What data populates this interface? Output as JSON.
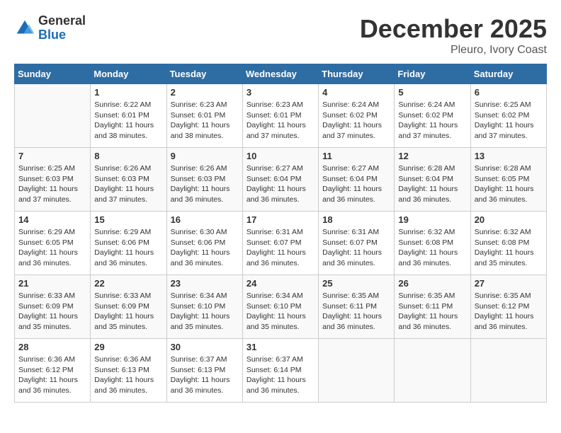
{
  "header": {
    "logo_general": "General",
    "logo_blue": "Blue",
    "month_title": "December 2025",
    "location": "Pleuro, Ivory Coast"
  },
  "weekdays": [
    "Sunday",
    "Monday",
    "Tuesday",
    "Wednesday",
    "Thursday",
    "Friday",
    "Saturday"
  ],
  "weeks": [
    [
      {
        "day": "",
        "sunrise": "",
        "sunset": "",
        "daylight": ""
      },
      {
        "day": "1",
        "sunrise": "Sunrise: 6:22 AM",
        "sunset": "Sunset: 6:01 PM",
        "daylight": "Daylight: 11 hours and 38 minutes."
      },
      {
        "day": "2",
        "sunrise": "Sunrise: 6:23 AM",
        "sunset": "Sunset: 6:01 PM",
        "daylight": "Daylight: 11 hours and 38 minutes."
      },
      {
        "day": "3",
        "sunrise": "Sunrise: 6:23 AM",
        "sunset": "Sunset: 6:01 PM",
        "daylight": "Daylight: 11 hours and 37 minutes."
      },
      {
        "day": "4",
        "sunrise": "Sunrise: 6:24 AM",
        "sunset": "Sunset: 6:02 PM",
        "daylight": "Daylight: 11 hours and 37 minutes."
      },
      {
        "day": "5",
        "sunrise": "Sunrise: 6:24 AM",
        "sunset": "Sunset: 6:02 PM",
        "daylight": "Daylight: 11 hours and 37 minutes."
      },
      {
        "day": "6",
        "sunrise": "Sunrise: 6:25 AM",
        "sunset": "Sunset: 6:02 PM",
        "daylight": "Daylight: 11 hours and 37 minutes."
      }
    ],
    [
      {
        "day": "7",
        "sunrise": "Sunrise: 6:25 AM",
        "sunset": "Sunset: 6:03 PM",
        "daylight": "Daylight: 11 hours and 37 minutes."
      },
      {
        "day": "8",
        "sunrise": "Sunrise: 6:26 AM",
        "sunset": "Sunset: 6:03 PM",
        "daylight": "Daylight: 11 hours and 37 minutes."
      },
      {
        "day": "9",
        "sunrise": "Sunrise: 6:26 AM",
        "sunset": "Sunset: 6:03 PM",
        "daylight": "Daylight: 11 hours and 36 minutes."
      },
      {
        "day": "10",
        "sunrise": "Sunrise: 6:27 AM",
        "sunset": "Sunset: 6:04 PM",
        "daylight": "Daylight: 11 hours and 36 minutes."
      },
      {
        "day": "11",
        "sunrise": "Sunrise: 6:27 AM",
        "sunset": "Sunset: 6:04 PM",
        "daylight": "Daylight: 11 hours and 36 minutes."
      },
      {
        "day": "12",
        "sunrise": "Sunrise: 6:28 AM",
        "sunset": "Sunset: 6:04 PM",
        "daylight": "Daylight: 11 hours and 36 minutes."
      },
      {
        "day": "13",
        "sunrise": "Sunrise: 6:28 AM",
        "sunset": "Sunset: 6:05 PM",
        "daylight": "Daylight: 11 hours and 36 minutes."
      }
    ],
    [
      {
        "day": "14",
        "sunrise": "Sunrise: 6:29 AM",
        "sunset": "Sunset: 6:05 PM",
        "daylight": "Daylight: 11 hours and 36 minutes."
      },
      {
        "day": "15",
        "sunrise": "Sunrise: 6:29 AM",
        "sunset": "Sunset: 6:06 PM",
        "daylight": "Daylight: 11 hours and 36 minutes."
      },
      {
        "day": "16",
        "sunrise": "Sunrise: 6:30 AM",
        "sunset": "Sunset: 6:06 PM",
        "daylight": "Daylight: 11 hours and 36 minutes."
      },
      {
        "day": "17",
        "sunrise": "Sunrise: 6:31 AM",
        "sunset": "Sunset: 6:07 PM",
        "daylight": "Daylight: 11 hours and 36 minutes."
      },
      {
        "day": "18",
        "sunrise": "Sunrise: 6:31 AM",
        "sunset": "Sunset: 6:07 PM",
        "daylight": "Daylight: 11 hours and 36 minutes."
      },
      {
        "day": "19",
        "sunrise": "Sunrise: 6:32 AM",
        "sunset": "Sunset: 6:08 PM",
        "daylight": "Daylight: 11 hours and 36 minutes."
      },
      {
        "day": "20",
        "sunrise": "Sunrise: 6:32 AM",
        "sunset": "Sunset: 6:08 PM",
        "daylight": "Daylight: 11 hours and 35 minutes."
      }
    ],
    [
      {
        "day": "21",
        "sunrise": "Sunrise: 6:33 AM",
        "sunset": "Sunset: 6:09 PM",
        "daylight": "Daylight: 11 hours and 35 minutes."
      },
      {
        "day": "22",
        "sunrise": "Sunrise: 6:33 AM",
        "sunset": "Sunset: 6:09 PM",
        "daylight": "Daylight: 11 hours and 35 minutes."
      },
      {
        "day": "23",
        "sunrise": "Sunrise: 6:34 AM",
        "sunset": "Sunset: 6:10 PM",
        "daylight": "Daylight: 11 hours and 35 minutes."
      },
      {
        "day": "24",
        "sunrise": "Sunrise: 6:34 AM",
        "sunset": "Sunset: 6:10 PM",
        "daylight": "Daylight: 11 hours and 35 minutes."
      },
      {
        "day": "25",
        "sunrise": "Sunrise: 6:35 AM",
        "sunset": "Sunset: 6:11 PM",
        "daylight": "Daylight: 11 hours and 36 minutes."
      },
      {
        "day": "26",
        "sunrise": "Sunrise: 6:35 AM",
        "sunset": "Sunset: 6:11 PM",
        "daylight": "Daylight: 11 hours and 36 minutes."
      },
      {
        "day": "27",
        "sunrise": "Sunrise: 6:35 AM",
        "sunset": "Sunset: 6:12 PM",
        "daylight": "Daylight: 11 hours and 36 minutes."
      }
    ],
    [
      {
        "day": "28",
        "sunrise": "Sunrise: 6:36 AM",
        "sunset": "Sunset: 6:12 PM",
        "daylight": "Daylight: 11 hours and 36 minutes."
      },
      {
        "day": "29",
        "sunrise": "Sunrise: 6:36 AM",
        "sunset": "Sunset: 6:13 PM",
        "daylight": "Daylight: 11 hours and 36 minutes."
      },
      {
        "day": "30",
        "sunrise": "Sunrise: 6:37 AM",
        "sunset": "Sunset: 6:13 PM",
        "daylight": "Daylight: 11 hours and 36 minutes."
      },
      {
        "day": "31",
        "sunrise": "Sunrise: 6:37 AM",
        "sunset": "Sunset: 6:14 PM",
        "daylight": "Daylight: 11 hours and 36 minutes."
      },
      {
        "day": "",
        "sunrise": "",
        "sunset": "",
        "daylight": ""
      },
      {
        "day": "",
        "sunrise": "",
        "sunset": "",
        "daylight": ""
      },
      {
        "day": "",
        "sunrise": "",
        "sunset": "",
        "daylight": ""
      }
    ]
  ]
}
